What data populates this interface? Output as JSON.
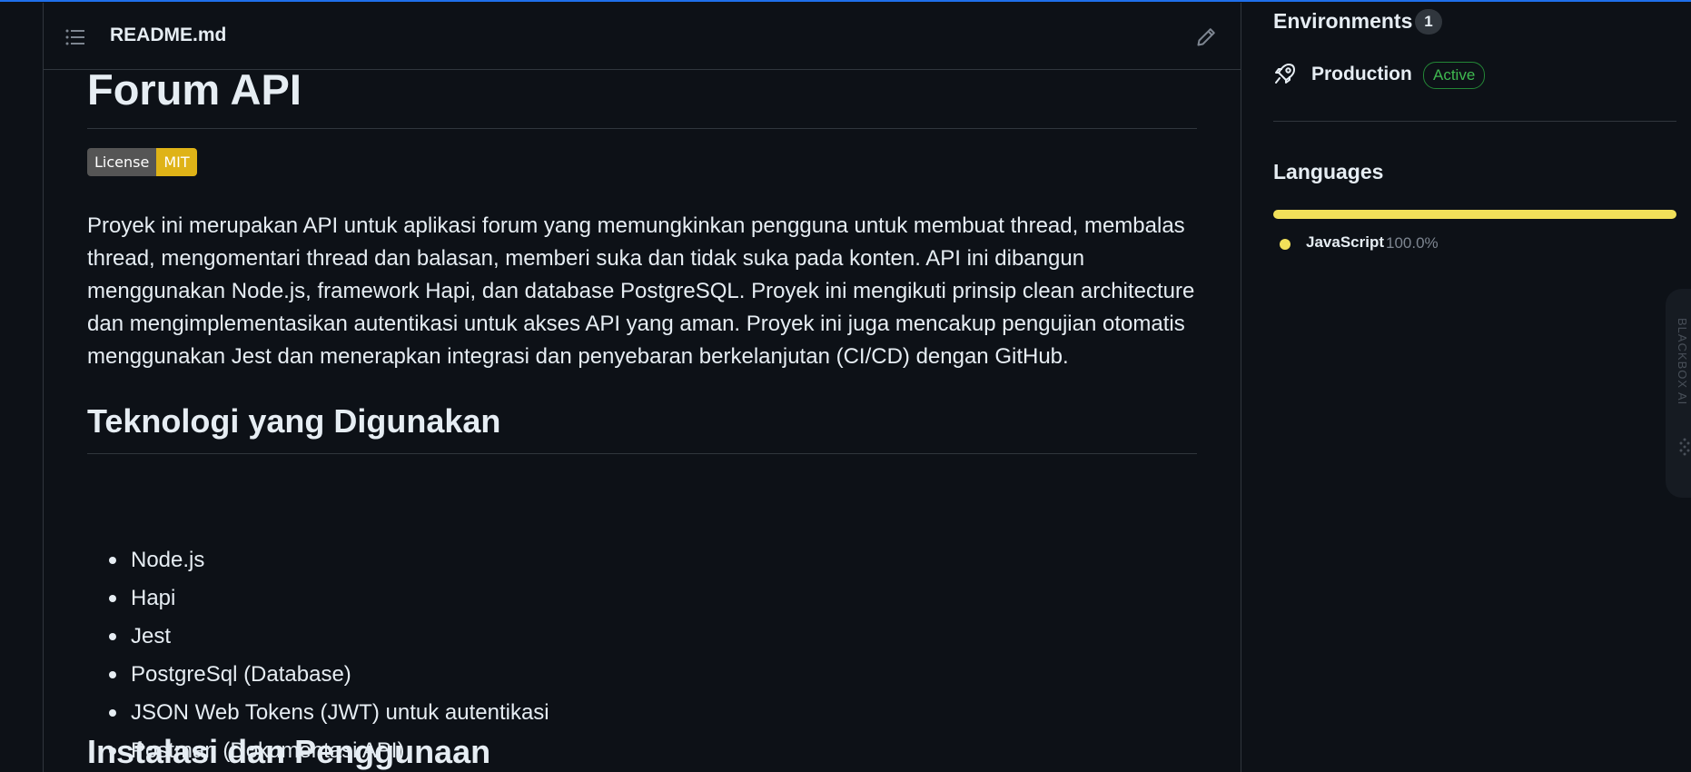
{
  "readme": {
    "filename": "README.md",
    "title": "Forum API",
    "badge": {
      "label": "License",
      "value": "MIT",
      "color": "#dfb317"
    },
    "intro": "Proyek ini merupakan API untuk aplikasi forum yang memungkinkan pengguna untuk membuat thread, membalas thread, mengomentari thread dan balasan, memberi suka dan tidak suka pada konten. API ini dibangun menggunakan Node.js, framework Hapi, dan database PostgreSQL. Proyek ini mengikuti prinsip clean architecture dan mengimplementasikan autentikasi untuk akses API yang aman. Proyek ini juga mencakup pengujian otomatis menggunakan Jest dan menerapkan integrasi dan penyebaran berkelanjutan (CI/CD) dengan GitHub.",
    "tech_heading": "Teknologi yang Digunakan",
    "tech_items": [
      "Node.js",
      "Hapi",
      "Jest",
      "PostgreSql (Database)",
      "JSON Web Tokens (JWT) untuk autentikasi",
      "Postman (Dokumentasi API)"
    ],
    "install_heading": "Instalasi dan Penggunaan"
  },
  "sidebar": {
    "environments_title": "Environments",
    "environments_count": "1",
    "environment": {
      "name": "Production",
      "status": "Active"
    },
    "languages_title": "Languages",
    "languages": [
      {
        "name": "JavaScript",
        "percent_label": "100.0%",
        "fraction": 1.0,
        "color": "#f1e05a"
      }
    ]
  },
  "side_tab": {
    "text": "BLACKBOX AI"
  },
  "icons": {
    "toc": "list-icon",
    "edit": "pencil-icon",
    "environment": "rocket-icon"
  },
  "colors": {
    "background": "#0d1117",
    "border": "#30363d",
    "accent": "#1f6feb",
    "active_green": "#3fb950"
  }
}
